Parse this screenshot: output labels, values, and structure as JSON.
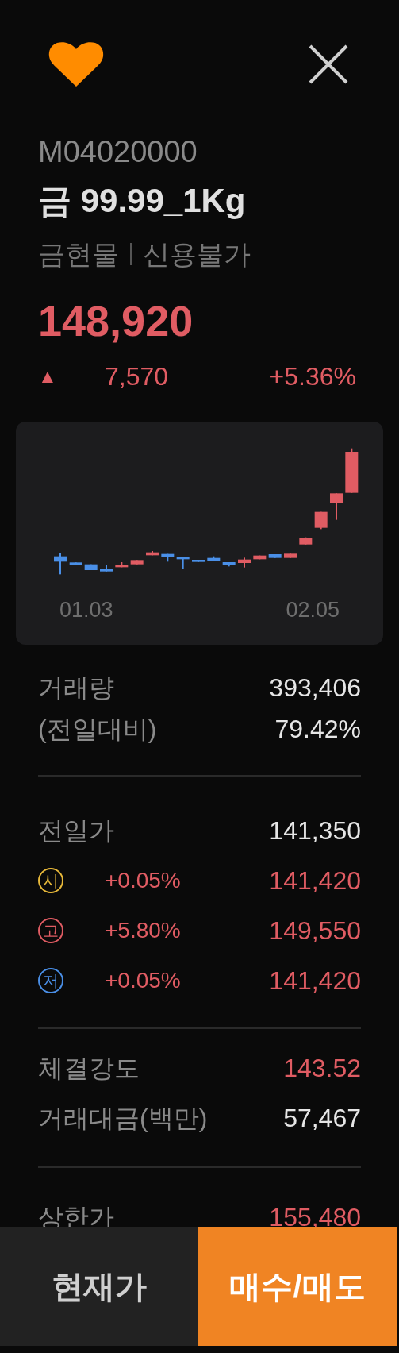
{
  "header": {
    "favorite": true
  },
  "product": {
    "code": "M04020000",
    "name": "금 99.99_1Kg",
    "category": "금현물",
    "credit": "신용불가"
  },
  "quote": {
    "price": "148,920",
    "direction_symbol": "▲",
    "change": "7,570",
    "change_rate": "+5.36%"
  },
  "chart": {
    "date_labels": [
      "01.03",
      "02.05"
    ]
  },
  "volume": [
    {
      "label": "거래량",
      "value": "393,406"
    },
    {
      "label": "(전일대비)",
      "value": "79.42%"
    }
  ],
  "prices": [
    {
      "kind": "plain",
      "label": "전일가",
      "value": "141,350",
      "rising": false
    },
    {
      "kind": "badge",
      "badge": "시",
      "color": "#e8b93a",
      "rate": "+0.05%",
      "value": "141,420",
      "rising": true
    },
    {
      "kind": "badge",
      "badge": "고",
      "color": "#e05c63",
      "rate": "+5.80%",
      "value": "149,550",
      "rising": true
    },
    {
      "kind": "badge",
      "badge": "저",
      "color": "#4a8fe7",
      "rate": "+0.05%",
      "value": "141,420",
      "rising": true
    }
  ],
  "strength": [
    {
      "label": "체결강도",
      "value": "143.52",
      "rising": true
    },
    {
      "label": "거래대금(백만)",
      "value": "57,467",
      "rising": false
    }
  ],
  "limits": [
    {
      "label": "상한가",
      "value": "155,480",
      "rising": true
    }
  ],
  "bottom_bar": [
    {
      "label": "현재가",
      "selected": false
    },
    {
      "label": "매수/매도",
      "selected": true
    }
  ]
}
